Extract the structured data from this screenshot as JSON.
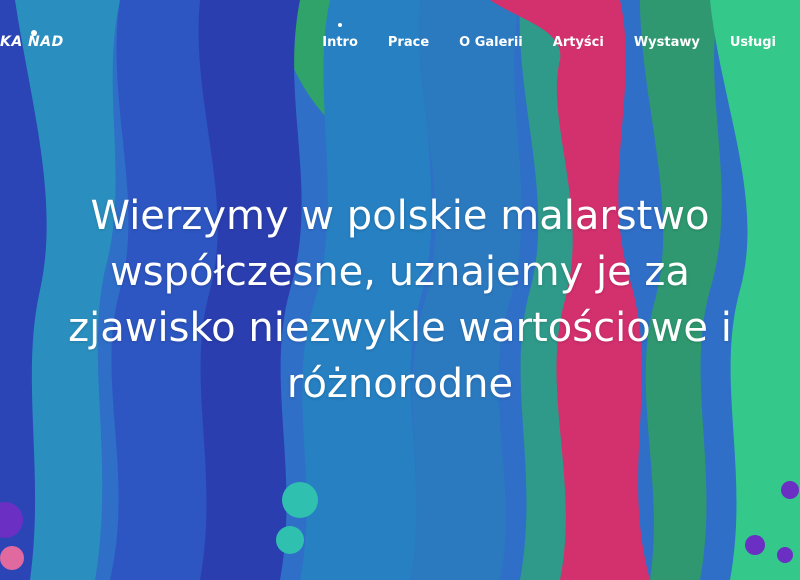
{
  "brand": {
    "logo_text": "KA NAD",
    "accent_white": "#ffffff"
  },
  "nav": {
    "items": [
      {
        "label": "Intro",
        "active": true
      },
      {
        "label": "Prace",
        "active": false
      },
      {
        "label": "O Galerii",
        "active": false
      },
      {
        "label": "Artyści",
        "active": false
      },
      {
        "label": "Wystawy",
        "active": false
      },
      {
        "label": "Usługi",
        "active": false
      }
    ]
  },
  "hero": {
    "headline": "Wierzymy w polskie malarstwo współczesne, uznajemy je za zjawisko niezwykle wartościowe i różnorodne"
  },
  "palette": {
    "blue": "#2f6fc8",
    "deep_blue": "#2b45b6",
    "teal": "#2aa3a7",
    "green": "#34c88a",
    "pink": "#d3306e",
    "purple": "#6b2fc4"
  }
}
